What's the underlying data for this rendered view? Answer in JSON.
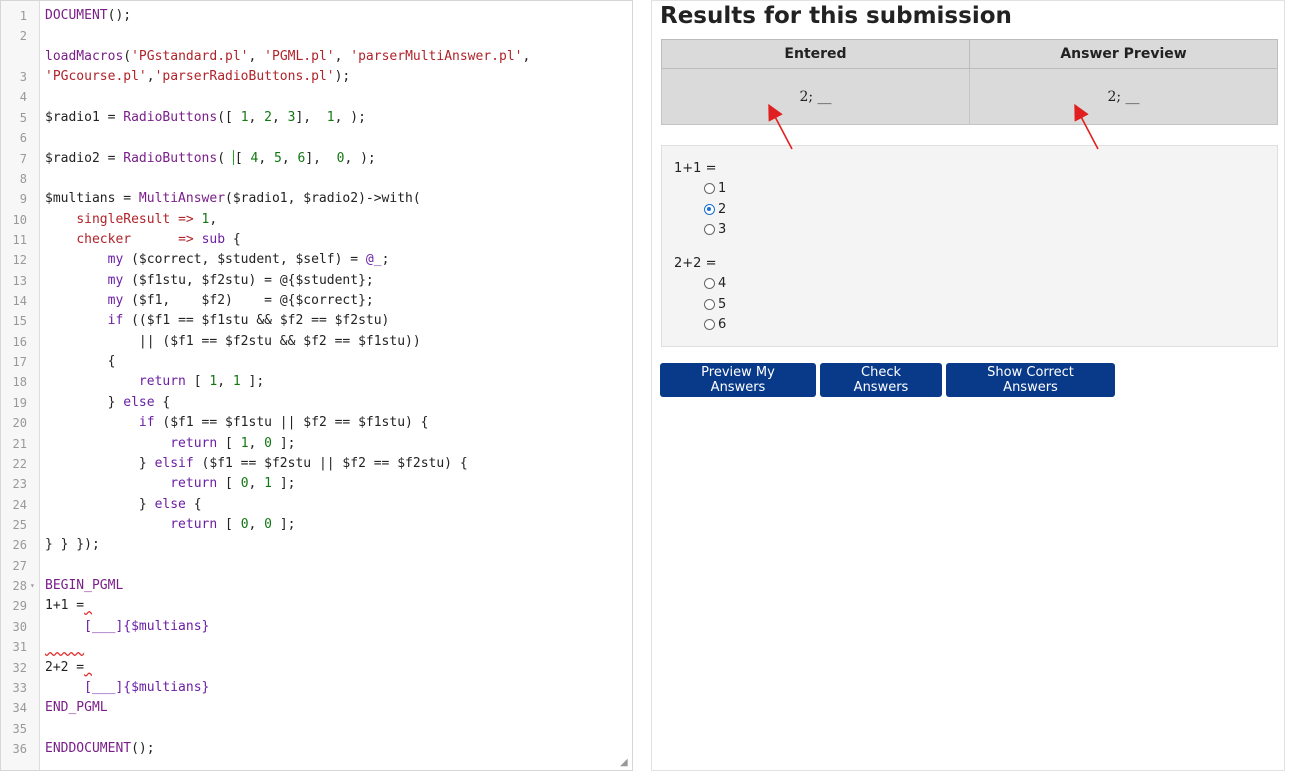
{
  "editor": {
    "lines": [
      {
        "n": "1",
        "code": "DOCUMENT();"
      },
      {
        "n": "2",
        "code": ""
      },
      {
        "n": "3",
        "code": "loadMacros('PGstandard.pl', 'PGML.pl', 'parserMultiAnswer.pl', 'PGcourse.pl','parserRadioButtons.pl');"
      },
      {
        "n": "4",
        "code": ""
      },
      {
        "n": "5",
        "code": "$radio1 = RadioButtons([ 1, 2, 3],  1, );"
      },
      {
        "n": "6",
        "code": ""
      },
      {
        "n": "7",
        "code": "$radio2 = RadioButtons( [ 4, 5, 6],  0, );"
      },
      {
        "n": "8",
        "code": ""
      },
      {
        "n": "9",
        "code": "$multians = MultiAnswer($radio1, $radio2)->with("
      },
      {
        "n": "10",
        "code": "    singleResult => 1,"
      },
      {
        "n": "11",
        "code": "    checker      => sub {"
      },
      {
        "n": "12",
        "code": "        my ($correct, $student, $self) = @_;"
      },
      {
        "n": "13",
        "code": "        my ($f1stu, $f2stu) = @{$student};"
      },
      {
        "n": "14",
        "code": "        my ($f1,    $f2)    = @{$correct};"
      },
      {
        "n": "15",
        "code": "        if (($f1 == $f1stu && $f2 == $f2stu)"
      },
      {
        "n": "16",
        "code": "            || ($f1 == $f2stu && $f2 == $f1stu))"
      },
      {
        "n": "17",
        "code": "        {"
      },
      {
        "n": "18",
        "code": "            return [ 1, 1 ];"
      },
      {
        "n": "19",
        "code": "        } else {"
      },
      {
        "n": "20",
        "code": "            if ($f1 == $f1stu || $f2 == $f1stu) {"
      },
      {
        "n": "21",
        "code": "                return [ 1, 0 ];"
      },
      {
        "n": "22",
        "code": "            } elsif ($f1 == $f2stu || $f2 == $f2stu) {"
      },
      {
        "n": "23",
        "code": "                return [ 0, 1 ];"
      },
      {
        "n": "24",
        "code": "            } else {"
      },
      {
        "n": "25",
        "code": "                return [ 0, 0 ];"
      },
      {
        "n": "26",
        "code": "} } });"
      },
      {
        "n": "27",
        "code": ""
      },
      {
        "n": "28",
        "code": "BEGIN_PGML"
      },
      {
        "n": "29",
        "code": "1+1 = "
      },
      {
        "n": "30",
        "code": "     [___]{$multians}"
      },
      {
        "n": "31",
        "code": ""
      },
      {
        "n": "32",
        "code": "2+2 = "
      },
      {
        "n": "33",
        "code": "     [___]{$multians}"
      },
      {
        "n": "34",
        "code": "END_PGML"
      },
      {
        "n": "35",
        "code": ""
      },
      {
        "n": "36",
        "code": "ENDDOCUMENT();"
      }
    ]
  },
  "results": {
    "title": "Results for this submission",
    "col_entered": "Entered",
    "col_preview": "Answer Preview",
    "entered_value": "2; __",
    "preview_value": "2; __"
  },
  "question": {
    "q1": {
      "label": "1+1 =",
      "options": [
        "1",
        "2",
        "3"
      ],
      "selected": "2"
    },
    "q2": {
      "label": "2+2 =",
      "options": [
        "4",
        "5",
        "6"
      ],
      "selected": ""
    }
  },
  "buttons": {
    "preview": "Preview My Answers",
    "check": "Check Answers",
    "show": "Show Correct Answers"
  },
  "colors": {
    "button_bg": "#093a8a",
    "annotation_arrow": "#e02020",
    "radio_selected": "#1a6fd1"
  }
}
